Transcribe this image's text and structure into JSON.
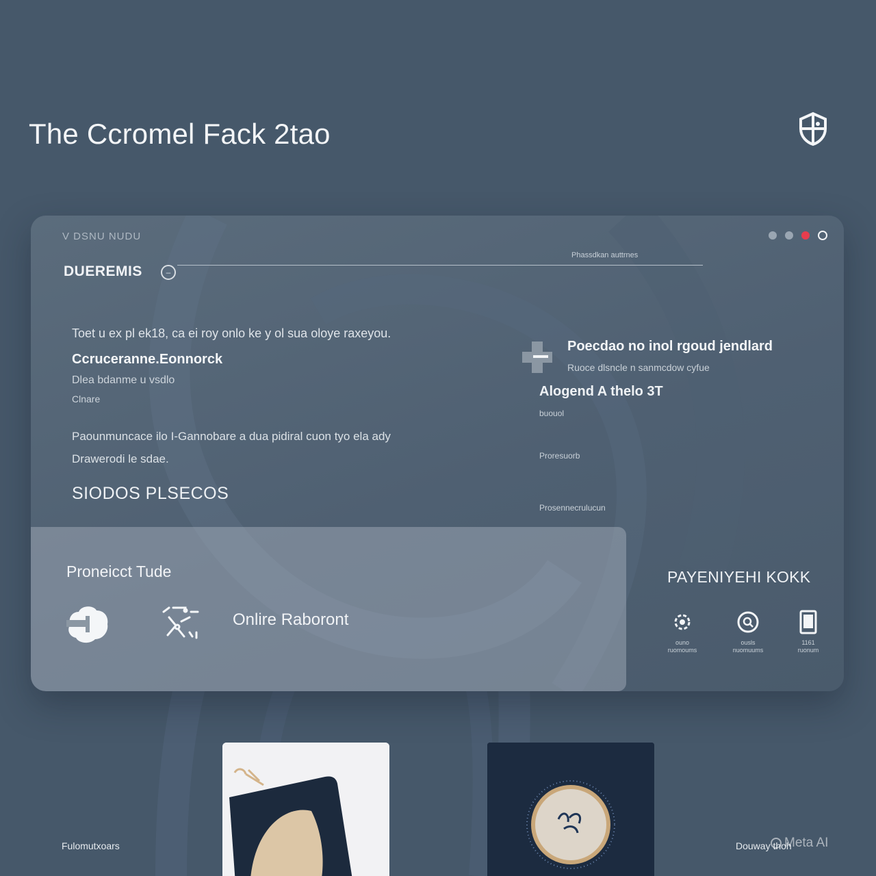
{
  "page": {
    "title": "The Ccromel Fack 2tao",
    "brand_logo": "shield-logo"
  },
  "card": {
    "kicker": "V DSNU NUDU",
    "heading": "DUEREMIS",
    "rule_caption": "Phassdkan auttrnes",
    "window_dots": [
      "grey",
      "grey",
      "red",
      "ring"
    ],
    "left": {
      "lead": "Toet u ex pl ek18, ca ei roy onlo ke y ol sua oloye raxeyou.",
      "lead_title": "Ccruceranne.Eonnorck",
      "lead_sub": "Dlea bdanme u vsdlo",
      "lead_note": "Clnare",
      "body_line1": "Paounmuncace ilo I-Gannobare a dua pidiral cuon tyo ela ady",
      "body_line2": "Drawerodi le sdae.",
      "status_caps": "SIODOS PLSECOS"
    },
    "right": {
      "feature_icon": "plus-cross-icon",
      "feature_title": "Poecdao no inol rgoud jendlard",
      "feature_sub": "Ruoce dlsncle n sanmcdow cyfue",
      "heading": "Alogend A thelo 3T",
      "note": "buouol",
      "link1": "Proresuorb",
      "link2": "Prosennecrulucun"
    },
    "product_panel": {
      "label": "Proneicct Tude",
      "icons": [
        "cloud-icon",
        "route-icon"
      ],
      "online_label": "Onlire Raboront"
    },
    "payment": {
      "title": "PAYENIYEHI KOKK",
      "options": [
        {
          "icon": "settings-cog-icon",
          "caption1": "ouno",
          "caption2": "ruomoums"
        },
        {
          "icon": "search-circle-icon",
          "caption1": "ousls",
          "caption2": "nuomuums"
        },
        {
          "icon": "card-icon",
          "caption1": "1161",
          "caption2": "ruonum"
        }
      ]
    }
  },
  "footer": {
    "left": "Fulomutxoars",
    "right": "Douway thoh",
    "watermark": "Meta AI"
  }
}
